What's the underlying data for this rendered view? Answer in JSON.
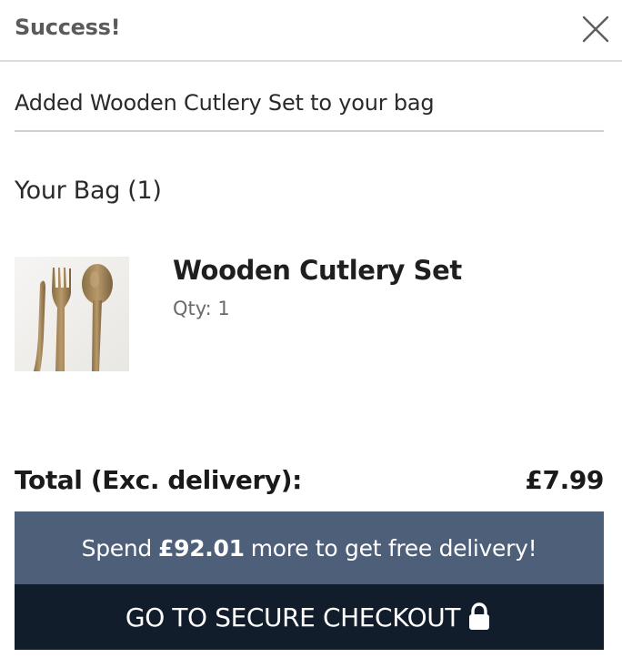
{
  "header": {
    "title": "Success!",
    "close_icon": "close-icon"
  },
  "notification": {
    "message": "Added Wooden Cutlery Set to your bag"
  },
  "bag": {
    "heading": "Your Bag (1)",
    "items": [
      {
        "name": "Wooden Cutlery Set",
        "qty": "Qty: 1",
        "image_icon": "product-image-wooden-cutlery"
      }
    ]
  },
  "summary": {
    "total_label": "Total (Exc. delivery):",
    "total_value": "£7.99"
  },
  "delivery": {
    "prefix": "Spend",
    "amount": "£92.01",
    "suffix": "more to get free delivery!"
  },
  "checkout": {
    "label": "GO TO SECURE CHECKOUT",
    "icon": "lock-icon"
  },
  "colors": {
    "banner": "#4e5f79",
    "checkout": "#121d2b",
    "header_text": "#5b5b5b"
  }
}
